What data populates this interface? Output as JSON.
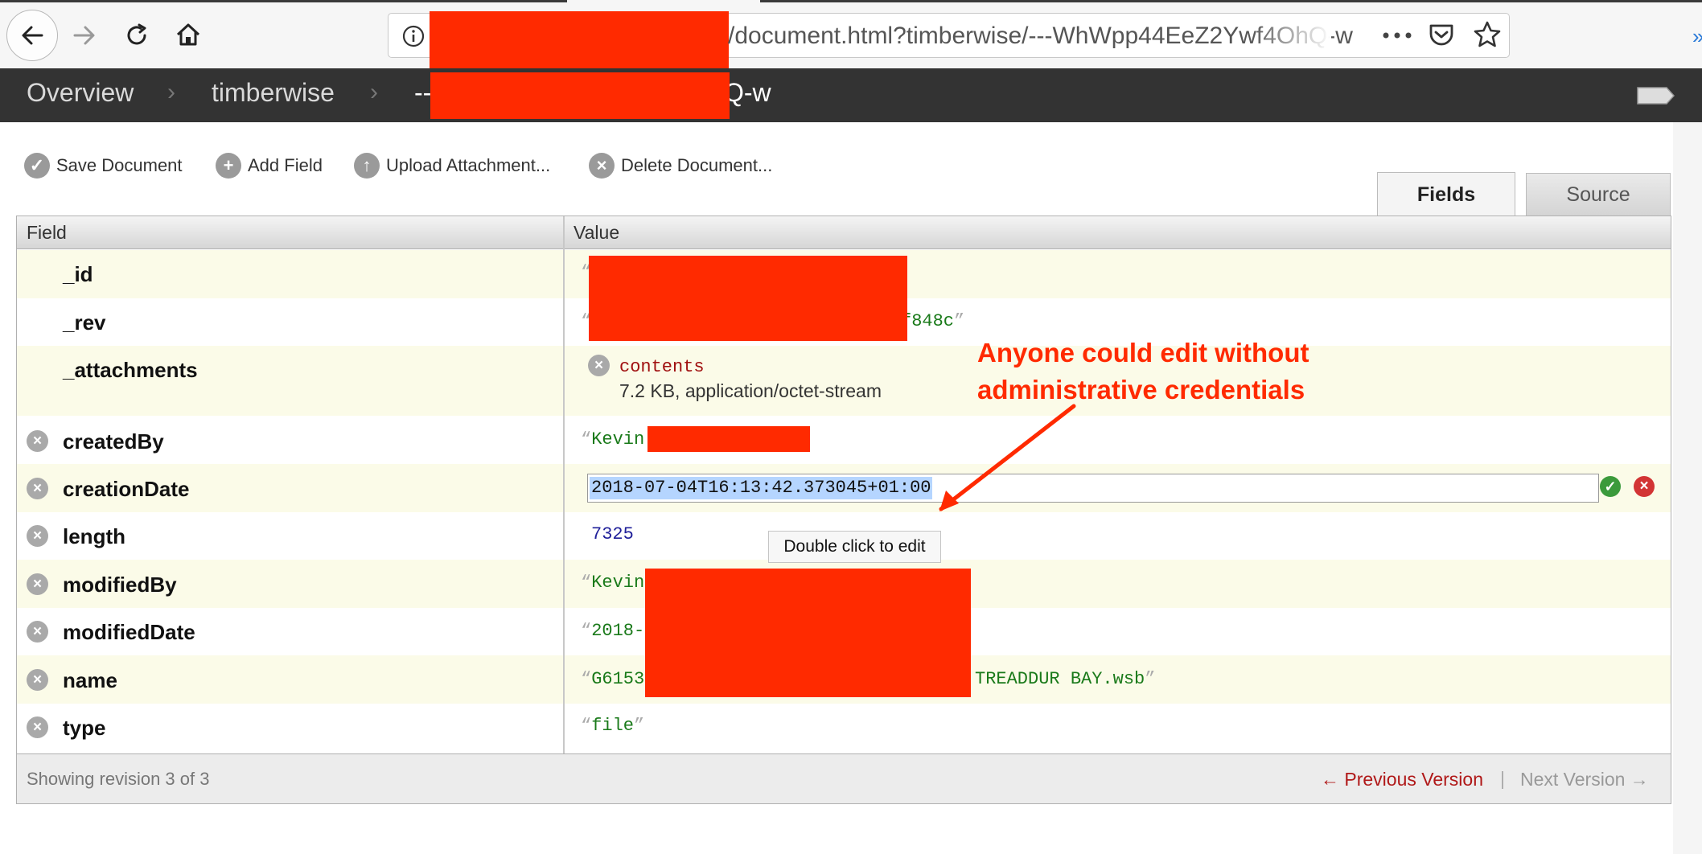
{
  "browser": {
    "url_suffix": "/document.html?timberwise/---WhWpp44EeZ2Ywf4OhQ-w",
    "icons": [
      "back-arrow-icon",
      "forward-arrow-icon",
      "reload-icon",
      "home-icon",
      "info-icon",
      "more-dots-icon",
      "pocket-icon",
      "bookmark-star-icon"
    ]
  },
  "header": {
    "crumbs": [
      "Overview",
      "timberwise"
    ],
    "doc_prefix": "--",
    "doc_suffix": "Q-w"
  },
  "actions": {
    "save": "Save Document",
    "add": "Add Field",
    "upload": "Upload Attachment...",
    "delete": "Delete Document..."
  },
  "tabs": {
    "fields": "Fields",
    "source": "Source"
  },
  "table": {
    "col_field": "Field",
    "col_value": "Value",
    "rows": {
      "id": {
        "name": "_id"
      },
      "rev": {
        "name": "_rev",
        "value_tail": "f848c"
      },
      "attachments": {
        "name": "_attachments",
        "file": "contents",
        "meta": "7.2 KB, application/octet-stream"
      },
      "createdBy": {
        "name": "createdBy",
        "value_head": "Kevin"
      },
      "creationDate": {
        "name": "creationDate",
        "edit_value": "2018-07-04T16:13:42.373045+01:00"
      },
      "length": {
        "name": "length",
        "value": "7325"
      },
      "modifiedBy": {
        "name": "modifiedBy",
        "value_head": "Kevin"
      },
      "modifiedDate": {
        "name": "modifiedDate",
        "value_head": "2018-"
      },
      "name": {
        "name": "name",
        "value_head": "G6153",
        "value_tail": "TREADDUR BAY.wsb"
      },
      "type": {
        "name": "type",
        "value": "file"
      }
    }
  },
  "tooltip": "Double click to edit",
  "footer": {
    "revision": "Showing revision 3 of 3",
    "prev": "← Previous Version",
    "sep": "|",
    "next": "Next Version →"
  },
  "annotation": {
    "line1": "Anyone could edit without",
    "line2": "administrative credentials"
  },
  "colors": {
    "redaction": "#ff2a00",
    "annotation": "#ff2a00",
    "link": "#b01818"
  }
}
